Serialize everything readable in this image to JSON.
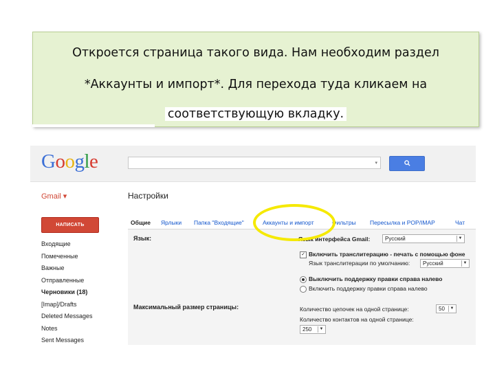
{
  "note": {
    "line1": "Откроется страница такого вида. Нам необходим раздел",
    "line2": "*Аккаунты и импорт*.  Для перехода туда кликаем на",
    "line3": "соответствующую вкладку."
  },
  "gmail": {
    "logo": {
      "letters": [
        "G",
        "o",
        "o",
        "g",
        "l",
        "e"
      ]
    },
    "search": {
      "value": "",
      "dropdown": "▾",
      "button_icon": "search-icon",
      "button_glyph": "🔍"
    },
    "app_label": "Gmail ▾",
    "page_title": "Настройки",
    "compose_label": "НАПИСАТЬ",
    "nav": [
      "Входящие",
      "Помеченные",
      "Важные",
      "Отправленные",
      "Черновики (18)",
      "[Imap]/Drafts",
      "Deleted Messages",
      "Notes",
      "Sent Messages"
    ],
    "tabs": [
      "Общие",
      "Ярлыки",
      "Папка \"Входящие\"",
      "Аккаунты и импорт",
      "Фильтры",
      "Пересылка и POP/IMAP",
      "Чат"
    ],
    "active_tab": "Общие",
    "settings": {
      "language_label": "Язык:",
      "interface_label": "Язык интерфейса Gmail:",
      "interface_value": "Русский",
      "translit_label": "Включить транслитерацию - печать с помощью фоне",
      "translit_checked": true,
      "translit_default_label": "Язык транслитерации по умолчанию:",
      "translit_default_value": "Русский",
      "rtl_off": "Выключить поддержку правки справа налево",
      "rtl_on": "Включить поддержку правки справа налево",
      "rtl_selected": "off",
      "page_size_label": "Максимальный размер страницы:",
      "threads_label": "Количество цепочек на одной странице:",
      "threads_value": "50",
      "contacts_label": "Количество контактов на одной странице:",
      "contacts_value": "250"
    },
    "highlight_color": "#f5e900"
  },
  "colors": {
    "note_bg": "#e6f2d2",
    "gmail_red": "#d14836",
    "link_blue": "#1155cc",
    "search_blue": "#4a7ee3"
  }
}
